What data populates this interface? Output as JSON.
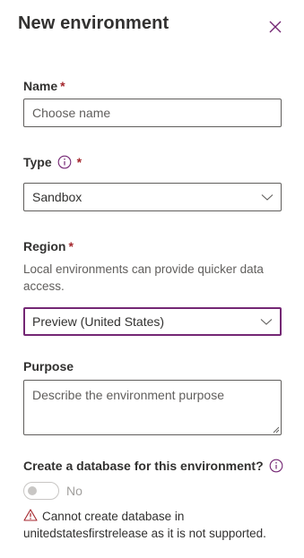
{
  "header": {
    "title": "New environment",
    "close_icon": "close-icon"
  },
  "name": {
    "label": "Name",
    "required_mark": "*",
    "placeholder": "Choose name",
    "value": ""
  },
  "type": {
    "label": "Type",
    "info_icon": "info-icon",
    "required_mark": "*",
    "selected": "Sandbox"
  },
  "region": {
    "label": "Region",
    "required_mark": "*",
    "helper": "Local environments can provide quicker data access.",
    "selected": "Preview (United States)"
  },
  "purpose": {
    "label": "Purpose",
    "placeholder": "Describe the environment purpose"
  },
  "database": {
    "label": "Create a database for this environment?",
    "info_icon": "info-icon",
    "toggle_state": "No",
    "toggle_on": false,
    "warning_icon": "warning-icon",
    "warning": "Cannot create database in unitedstatesfirstrelease as it is not supported."
  },
  "colors": {
    "accent": "#742774",
    "required": "#a4262c",
    "warning": "#a4262c",
    "text": "#323130",
    "muted": "#605e5c"
  }
}
